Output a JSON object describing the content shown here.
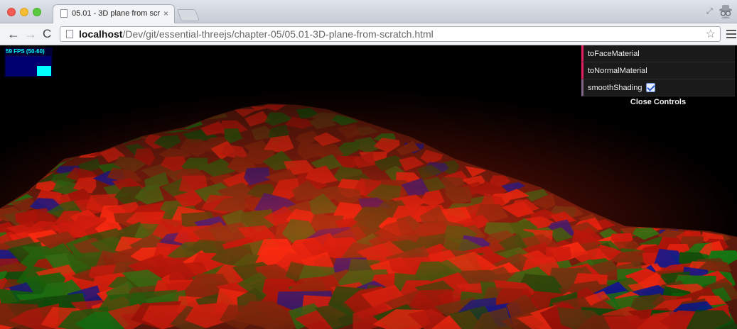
{
  "tab": {
    "title": "05.01 - 3D plane from scr",
    "close_glyph": "×"
  },
  "toolbar": {
    "back_glyph": "←",
    "forward_glyph": "→",
    "reload_glyph": "C",
    "url_host": "localhost",
    "url_path": "/Dev/git/essential-threejs/chapter-05/05.01-3D-plane-from-scratch.html",
    "star_glyph": "☆"
  },
  "stats": {
    "fps_text": "59 FPS (50-60)"
  },
  "gui": {
    "controls": [
      {
        "label": "toFaceMaterial",
        "type": "function"
      },
      {
        "label": "toNormalMaterial",
        "type": "function"
      },
      {
        "label": "smoothShading",
        "type": "boolean",
        "checked": true
      }
    ],
    "close_label": "Close Controls"
  },
  "icons": [
    "back-arrow-icon",
    "forward-arrow-icon",
    "reload-icon",
    "page-icon",
    "star-icon",
    "menu-icon",
    "incognito-icon"
  ],
  "colors": {
    "fps_text": "#00ffff",
    "gui_function_accent": "#e61d5f",
    "gui_boolean_accent": "#806787",
    "mesh_red": "#e02010",
    "mesh_green": "#0a6e0a",
    "mesh_blue": "#0018a0"
  }
}
